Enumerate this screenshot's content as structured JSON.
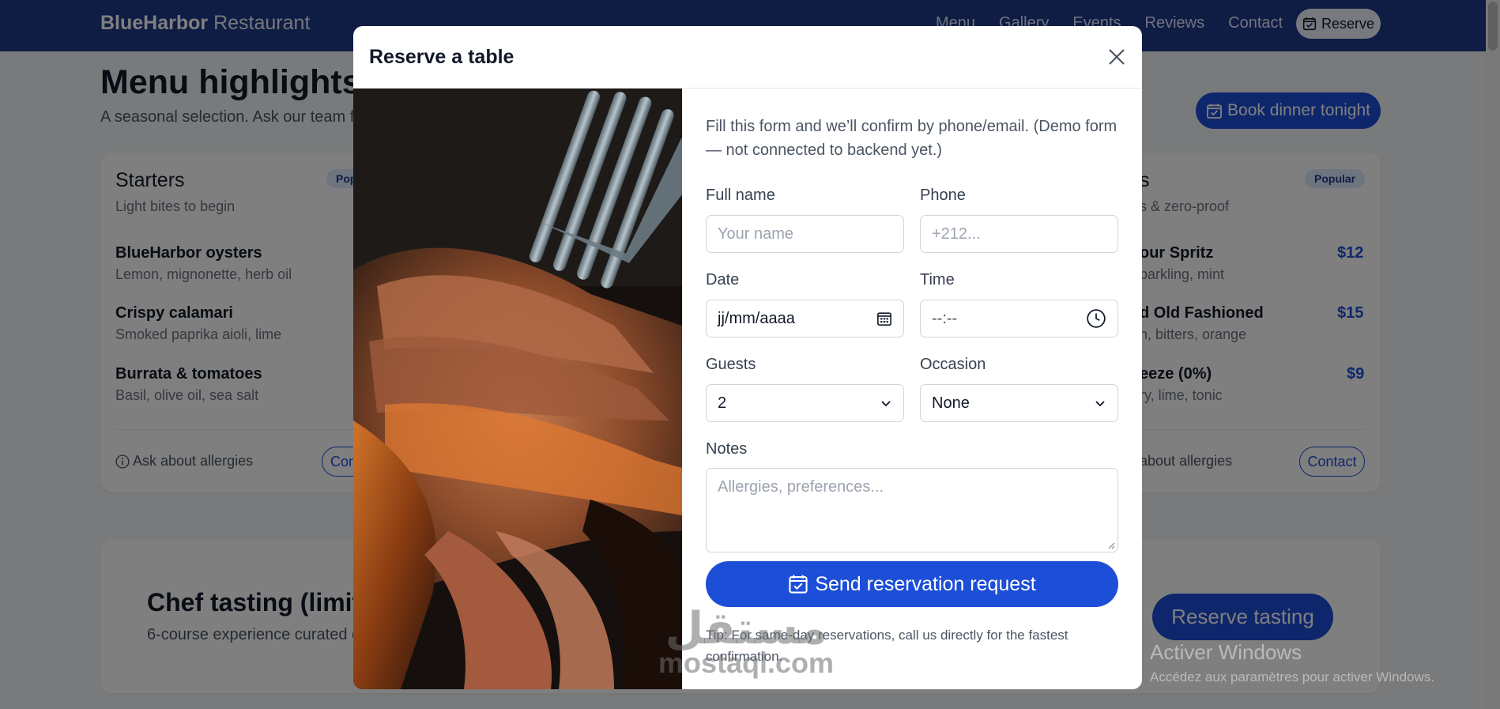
{
  "navbar": {
    "brand_bold": "BlueHarbor",
    "brand_rest": "Restaurant",
    "links": [
      "Menu",
      "Gallery",
      "Events",
      "Reviews",
      "Contact"
    ],
    "reserve_label": "Reserve"
  },
  "page": {
    "title": "Menu highlights",
    "subtitle": "A seasonal selection. Ask our team fo",
    "book_label": "Book dinner tonight"
  },
  "starters": {
    "title": "Starters",
    "subtitle": "Light bites to begin",
    "badge": "Pop",
    "items": [
      {
        "name": "BlueHarbor oysters",
        "desc": "Lemon, mignonette, herb oil"
      },
      {
        "name": "Crispy calamari",
        "desc": "Smoked paprika aioli, lime"
      },
      {
        "name": "Burrata & tomatoes",
        "desc": "Basil, olive oil, sea salt"
      }
    ],
    "allergy_label": "Ask about allergies",
    "contact_label": "Con"
  },
  "drinks": {
    "title": "s",
    "subtitle": "s & zero-proof",
    "badge": "Popular",
    "items": [
      {
        "name": "our Spritz",
        "desc": "parkling, mint",
        "price": "$12"
      },
      {
        "name": "d Old Fashioned",
        "desc": "n, bitters, orange",
        "price": "$15"
      },
      {
        "name": "eeze (0%)",
        "desc": "ry, lime, tonic",
        "price": "$9"
      }
    ],
    "allergy_label": "about allergies",
    "contact_label": "Contact"
  },
  "chef": {
    "title": "Chef tasting (limite",
    "subtitle": "6-course experience curated c",
    "button_label": "Reserve tasting"
  },
  "modal": {
    "title": "Reserve a table",
    "intro": "Fill this form and we’ll confirm by phone/email. (Demo form — not connected to backend yet.)",
    "fields": {
      "full_name": {
        "label": "Full name",
        "placeholder": "Your name"
      },
      "phone": {
        "label": "Phone",
        "placeholder": "+212..."
      },
      "date": {
        "label": "Date",
        "value": "jj/mm/aaaa"
      },
      "time": {
        "label": "Time",
        "value": "--:--"
      },
      "guests": {
        "label": "Guests",
        "value": "2"
      },
      "occasion": {
        "label": "Occasion",
        "value": "None"
      },
      "notes": {
        "label": "Notes",
        "placeholder": "Allergies, preferences..."
      }
    },
    "submit_label": "Send reservation request",
    "tip": "Tip: For same-day reservations, call us directly for the fastest confirmation."
  },
  "watermarks": {
    "logo_ar": "مستقل",
    "logo_latin": "mostaql.com",
    "activate_title": "Activer Windows",
    "activate_sub": "Accédez aux paramètres pour activer Windows."
  },
  "colors": {
    "navbar": "#1e3a8a",
    "accent": "#1d4ed8",
    "badge_bg": "#dbeafe"
  }
}
